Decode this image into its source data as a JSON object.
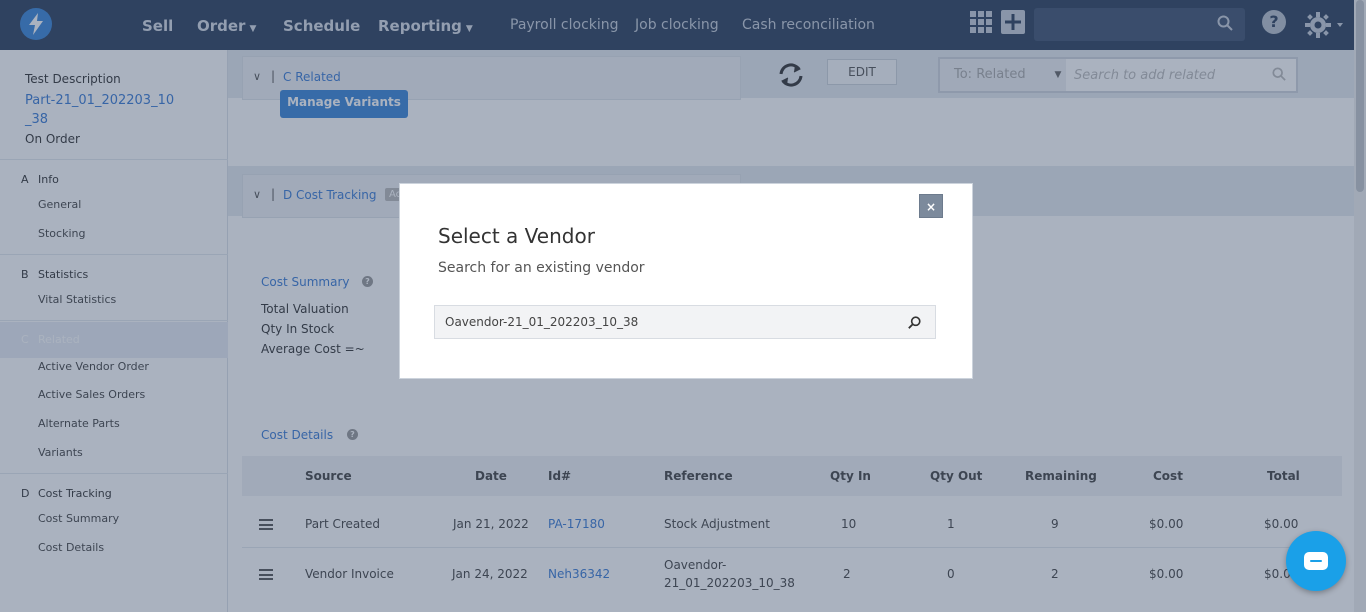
{
  "nav": {
    "main_items": [
      "Sell",
      "Order",
      "Schedule",
      "Reporting"
    ],
    "sub_items": [
      "Payroll clocking",
      "Job clocking",
      "Cash reconciliation"
    ],
    "search_value": "",
    "help_label": "?"
  },
  "sidebar": {
    "title": "Test Description",
    "part_number": "Part-21_01_202203_10_38",
    "status": "On Order",
    "sections": [
      {
        "letter": "A",
        "name": "Info",
        "items": [
          "General",
          "Stocking"
        ]
      },
      {
        "letter": "B",
        "name": "Statistics",
        "items": [
          "Vital Statistics"
        ]
      },
      {
        "letter": "C",
        "name": "Related",
        "items": [
          "Active Vendor Order",
          "Active Sales Orders",
          "Alternate Parts",
          "Variants"
        ]
      },
      {
        "letter": "D",
        "name": "Cost Tracking",
        "items": [
          "Cost Summary",
          "Cost Details"
        ]
      }
    ]
  },
  "main": {
    "section_c_label": "C Related",
    "manage_variants_label": "Manage Variants",
    "edit_label": "EDIT",
    "related_to_label": "To: Related",
    "related_search_placeholder": "Search to add related",
    "section_d_label": "D Cost Tracking",
    "section_d_tag": "Ac",
    "cost_summary": {
      "title": "Cost Summary",
      "lines": [
        "Total Valuation",
        "Qty In Stock",
        "Average Cost =~"
      ]
    },
    "cost_details": {
      "title": "Cost Details",
      "columns": [
        "Source",
        "Date",
        "Id#",
        "Reference",
        "Qty In",
        "Qty Out",
        "Remaining",
        "Cost",
        "Total"
      ],
      "rows": [
        {
          "source": "Part Created",
          "date": "Jan 21, 2022",
          "id": "PA-17180",
          "reference": "Stock Adjustment",
          "reference2": "",
          "qty_in": "10",
          "qty_out": "1",
          "remaining": "9",
          "cost": "$0.00",
          "total": "$0.00"
        },
        {
          "source": "Vendor Invoice",
          "date": "Jan 24, 2022",
          "id": "Neh36342",
          "reference": "Oavendor-",
          "reference2": "21_01_202203_10_38",
          "qty_in": "2",
          "qty_out": "0",
          "remaining": "2",
          "cost": "$0.00",
          "total": "$0.0"
        }
      ]
    }
  },
  "modal": {
    "close_label": "×",
    "title": "Select a Vendor",
    "subtitle": "Search for an existing vendor",
    "search_value": "Oavendor-21_01_202203_10_38"
  }
}
